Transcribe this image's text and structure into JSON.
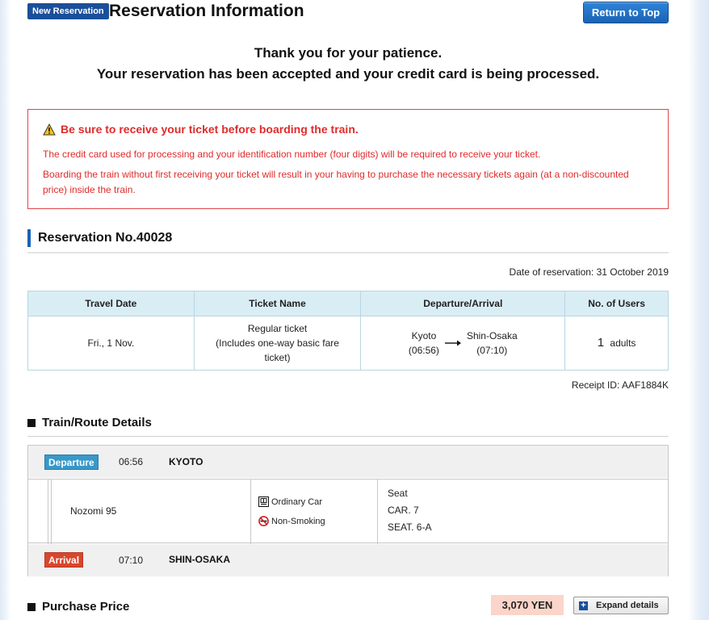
{
  "header": {
    "badge": "New Reservation",
    "title": "Reservation Information",
    "return_button": "Return to Top"
  },
  "thanks": {
    "line1": "Thank you for your patience.",
    "line2": "Your reservation has been accepted and your credit card is being processed."
  },
  "warning": {
    "icon": "warning-icon",
    "heading": "Be sure to receive your ticket before boarding the train.",
    "p1": "The credit card used for processing and your identification number (four digits) will be required to receive your ticket.",
    "p2a": "Boarding the train without first receiving your ticket will result in your having to purchase the necessary tickets again (at a non-discounted",
    "p2b": "price) inside the train.",
    "color": "#e02b2b"
  },
  "reservation": {
    "number_label": "Reservation No.40028",
    "date_label": "Date of reservation: 31 October 2019",
    "columns": [
      "Travel Date",
      "Ticket Name",
      "Departure/Arrival",
      "No. of Users"
    ],
    "travel_date": "Fri., 1 Nov.",
    "ticket_name_1": "Regular ticket",
    "ticket_name_2": "(Includes one-way basic fare",
    "ticket_name_3": "ticket)",
    "dep_station": "Kyoto",
    "dep_time": "(06:56)",
    "arr_station": "Shin-Osaka",
    "arr_time": "(07:10)",
    "users_count": "1",
    "users_unit": "adults",
    "receipt": "Receipt ID: AAF1884K"
  },
  "route": {
    "heading": "Train/Route Details",
    "departure": {
      "tag": "Departure",
      "time": "06:56",
      "station": "KYOTO"
    },
    "train": "Nozomi 95",
    "car_type": "Ordinary Car",
    "smoking": "Non-Smoking",
    "seat_label": "Seat",
    "car_no": "CAR. 7",
    "seat_no": "SEAT. 6-A",
    "arrival": {
      "tag": "Arrival",
      "time": "07:10",
      "station": "SHIN-OSAKA"
    }
  },
  "purchase": {
    "heading": "Purchase Price",
    "price": "3,070 YEN",
    "expand": "Expand details"
  },
  "colors": {
    "brand": "#1a63b5",
    "departure": "#3798c9",
    "arrival": "#d9462c",
    "price_bg": "#fbd5c9"
  }
}
